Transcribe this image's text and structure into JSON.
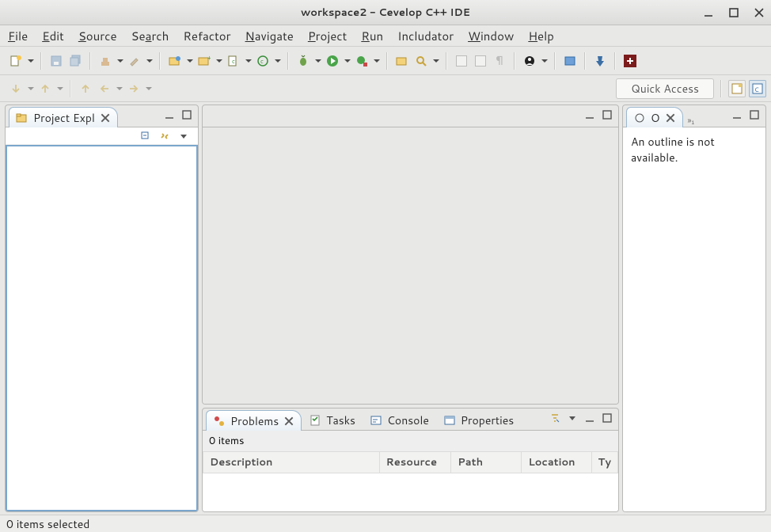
{
  "window": {
    "title": "workspace2 - Cevelop C++ IDE"
  },
  "menu": [
    "File",
    "Edit",
    "Source",
    "Search",
    "Refactor",
    "Navigate",
    "Project",
    "Run",
    "Includator",
    "Window",
    "Help"
  ],
  "toolbar": {
    "quick_access": "Quick Access"
  },
  "views": {
    "project_explorer": {
      "tab_label": "Project Expl"
    },
    "outline": {
      "tab_label": "O",
      "message": "An outline is not available."
    },
    "bottom": {
      "tabs": [
        "Problems",
        "Tasks",
        "Console",
        "Properties"
      ],
      "active_tab": 0,
      "problems": {
        "summary": "0 items",
        "columns": [
          "Description",
          "Resource",
          "Path",
          "Location",
          "Ty"
        ]
      }
    }
  },
  "status": {
    "text": "0 items selected"
  }
}
